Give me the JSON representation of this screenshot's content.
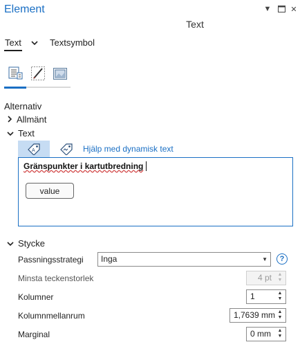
{
  "window": {
    "title": "Element",
    "subheader": "Text"
  },
  "tabs": {
    "text": "Text",
    "textsymbol": "Textsymbol"
  },
  "options": {
    "heading": "Alternativ",
    "general": "Allmänt",
    "text": "Text"
  },
  "dynamic": {
    "help_link": "Hjälp med dynamisk text"
  },
  "textbox": {
    "content": "Gränspunkter i kartutbredning",
    "value_button": "value"
  },
  "paragraph": {
    "heading": "Stycke",
    "fitting_label": "Passningsstrategi",
    "fitting_value": "Inga",
    "min_size_label": "Minsta teckenstorlek",
    "min_size_value": "4 pt",
    "columns_label": "Kolumner",
    "columns_value": "1",
    "gap_label": "Kolumnmellanrum",
    "gap_value": "1,7639 mm",
    "margin_label": "Marginal",
    "margin_value": "0 mm"
  },
  "colors": {
    "accent": "#1a6fc4",
    "active_tab_bg": "#c6dcf3"
  }
}
